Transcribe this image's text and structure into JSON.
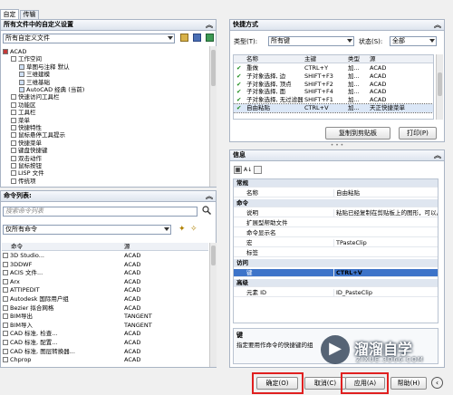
{
  "tabs": [
    "自定义",
    "传输"
  ],
  "left_top": {
    "title": "所有文件中的自定义设置",
    "combo": "所有自定义文件",
    "tree": [
      {
        "label": "ACAD",
        "indent": 0
      },
      {
        "label": "工作空间",
        "indent": 1
      },
      {
        "label": "草图与注释 默认",
        "indent": 2
      },
      {
        "label": "三维建模",
        "indent": 2
      },
      {
        "label": "三维基础",
        "indent": 2
      },
      {
        "label": "AutoCAD 经典 (当前)",
        "indent": 2
      },
      {
        "label": "快速访问工具栏",
        "indent": 1
      },
      {
        "label": "功能区",
        "indent": 1
      },
      {
        "label": "工具栏",
        "indent": 1
      },
      {
        "label": "菜单",
        "indent": 1
      },
      {
        "label": "快捷特性",
        "indent": 1
      },
      {
        "label": "鼠标悬停工具提示",
        "indent": 1
      },
      {
        "label": "快捷菜单",
        "indent": 1
      },
      {
        "label": "键盘快捷键",
        "indent": 1
      },
      {
        "label": "双击动作",
        "indent": 1
      },
      {
        "label": "鼠标按钮",
        "indent": 1
      },
      {
        "label": "LISP 文件",
        "indent": 1
      },
      {
        "label": "传统项",
        "indent": 1
      }
    ]
  },
  "left_bottom": {
    "title": "命令列表:",
    "search_placeholder": "搜索命令列表",
    "combo": "仅所有命令",
    "col_command": "命令",
    "col_source": "源",
    "commands": [
      {
        "name": "3D Studio...",
        "src": "ACAD"
      },
      {
        "name": "3DDWF",
        "src": "ACAD"
      },
      {
        "name": "ACIS 文件...",
        "src": "ACAD"
      },
      {
        "name": "Arx",
        "src": "ACAD"
      },
      {
        "name": "ATTIPEDIT",
        "src": "ACAD"
      },
      {
        "name": "Autodesk 国际用户组",
        "src": "ACAD"
      },
      {
        "name": "Bezier 拟合网格",
        "src": "ACAD"
      },
      {
        "name": "BIM导出",
        "src": "TANGENT"
      },
      {
        "name": "BIM导入",
        "src": "TANGENT"
      },
      {
        "name": "CAD 标准, 检查...",
        "src": "ACAD"
      },
      {
        "name": "CAD 标准, 配置...",
        "src": "ACAD"
      },
      {
        "name": "CAD 标准, 图层转换器...",
        "src": "ACAD"
      },
      {
        "name": "Chprop",
        "src": "ACAD"
      }
    ]
  },
  "shortcuts": {
    "title": "快捷方式",
    "type_label": "类型(T):",
    "type_value": "所有键",
    "status_label": "状态(S):",
    "status_value": "全部",
    "cols": [
      "名称",
      "主键",
      "类型",
      "源"
    ],
    "rows": [
      {
        "name": "重做",
        "key": "CTRL+Y",
        "type": "加...",
        "src": "ACAD"
      },
      {
        "name": "子对象选择, 边",
        "key": "SHIFT+F3",
        "type": "加...",
        "src": "ACAD"
      },
      {
        "name": "子对象选择, 顶点",
        "key": "SHIFT+F2",
        "type": "加...",
        "src": "ACAD"
      },
      {
        "name": "子对象选择, 面",
        "key": "SHIFT+F4",
        "type": "加...",
        "src": "ACAD"
      },
      {
        "name": "子对象选择, 无过滤器",
        "key": "SHIFT+F1",
        "type": "加...",
        "src": "ACAD"
      },
      {
        "name": "自由粘贴",
        "key": "CTRL+V",
        "type": "加...",
        "src": "天正快捷菜单"
      }
    ],
    "copy_btn": "复制到剪贴板",
    "print_btn": "打印(P)"
  },
  "info": {
    "title": "信息",
    "rows": [
      {
        "k": "常规",
        "v": "",
        "sec": true
      },
      {
        "k": "名称",
        "v": "自由粘贴"
      },
      {
        "k": "命令",
        "v": "",
        "sec": true
      },
      {
        "k": "说明",
        "v": "粘贴已经复制在剪贴板上的图形，可以从"
      },
      {
        "k": "扩展型帮助文件",
        "v": ""
      },
      {
        "k": "命令显示名",
        "v": ""
      },
      {
        "k": "宏",
        "v": "TPasteClip"
      },
      {
        "k": "标签",
        "v": ""
      },
      {
        "k": "访问",
        "v": "",
        "sec": true
      },
      {
        "k": "键",
        "v": "CTRL+V",
        "sel": true
      },
      {
        "k": "高级",
        "v": "",
        "sec": true
      },
      {
        "k": "元素 ID",
        "v": "ID_PasteClip"
      }
    ],
    "desc_title": "键",
    "desc_text": "指定要用作命令的快捷键的组"
  },
  "footer": {
    "ok": "确定(O)",
    "cancel": "取消(C)",
    "apply": "应用(A)",
    "help": "帮助(H)"
  },
  "watermark": {
    "brand": "溜溜自学",
    "url": "ZIXUE.3D66.COM"
  }
}
